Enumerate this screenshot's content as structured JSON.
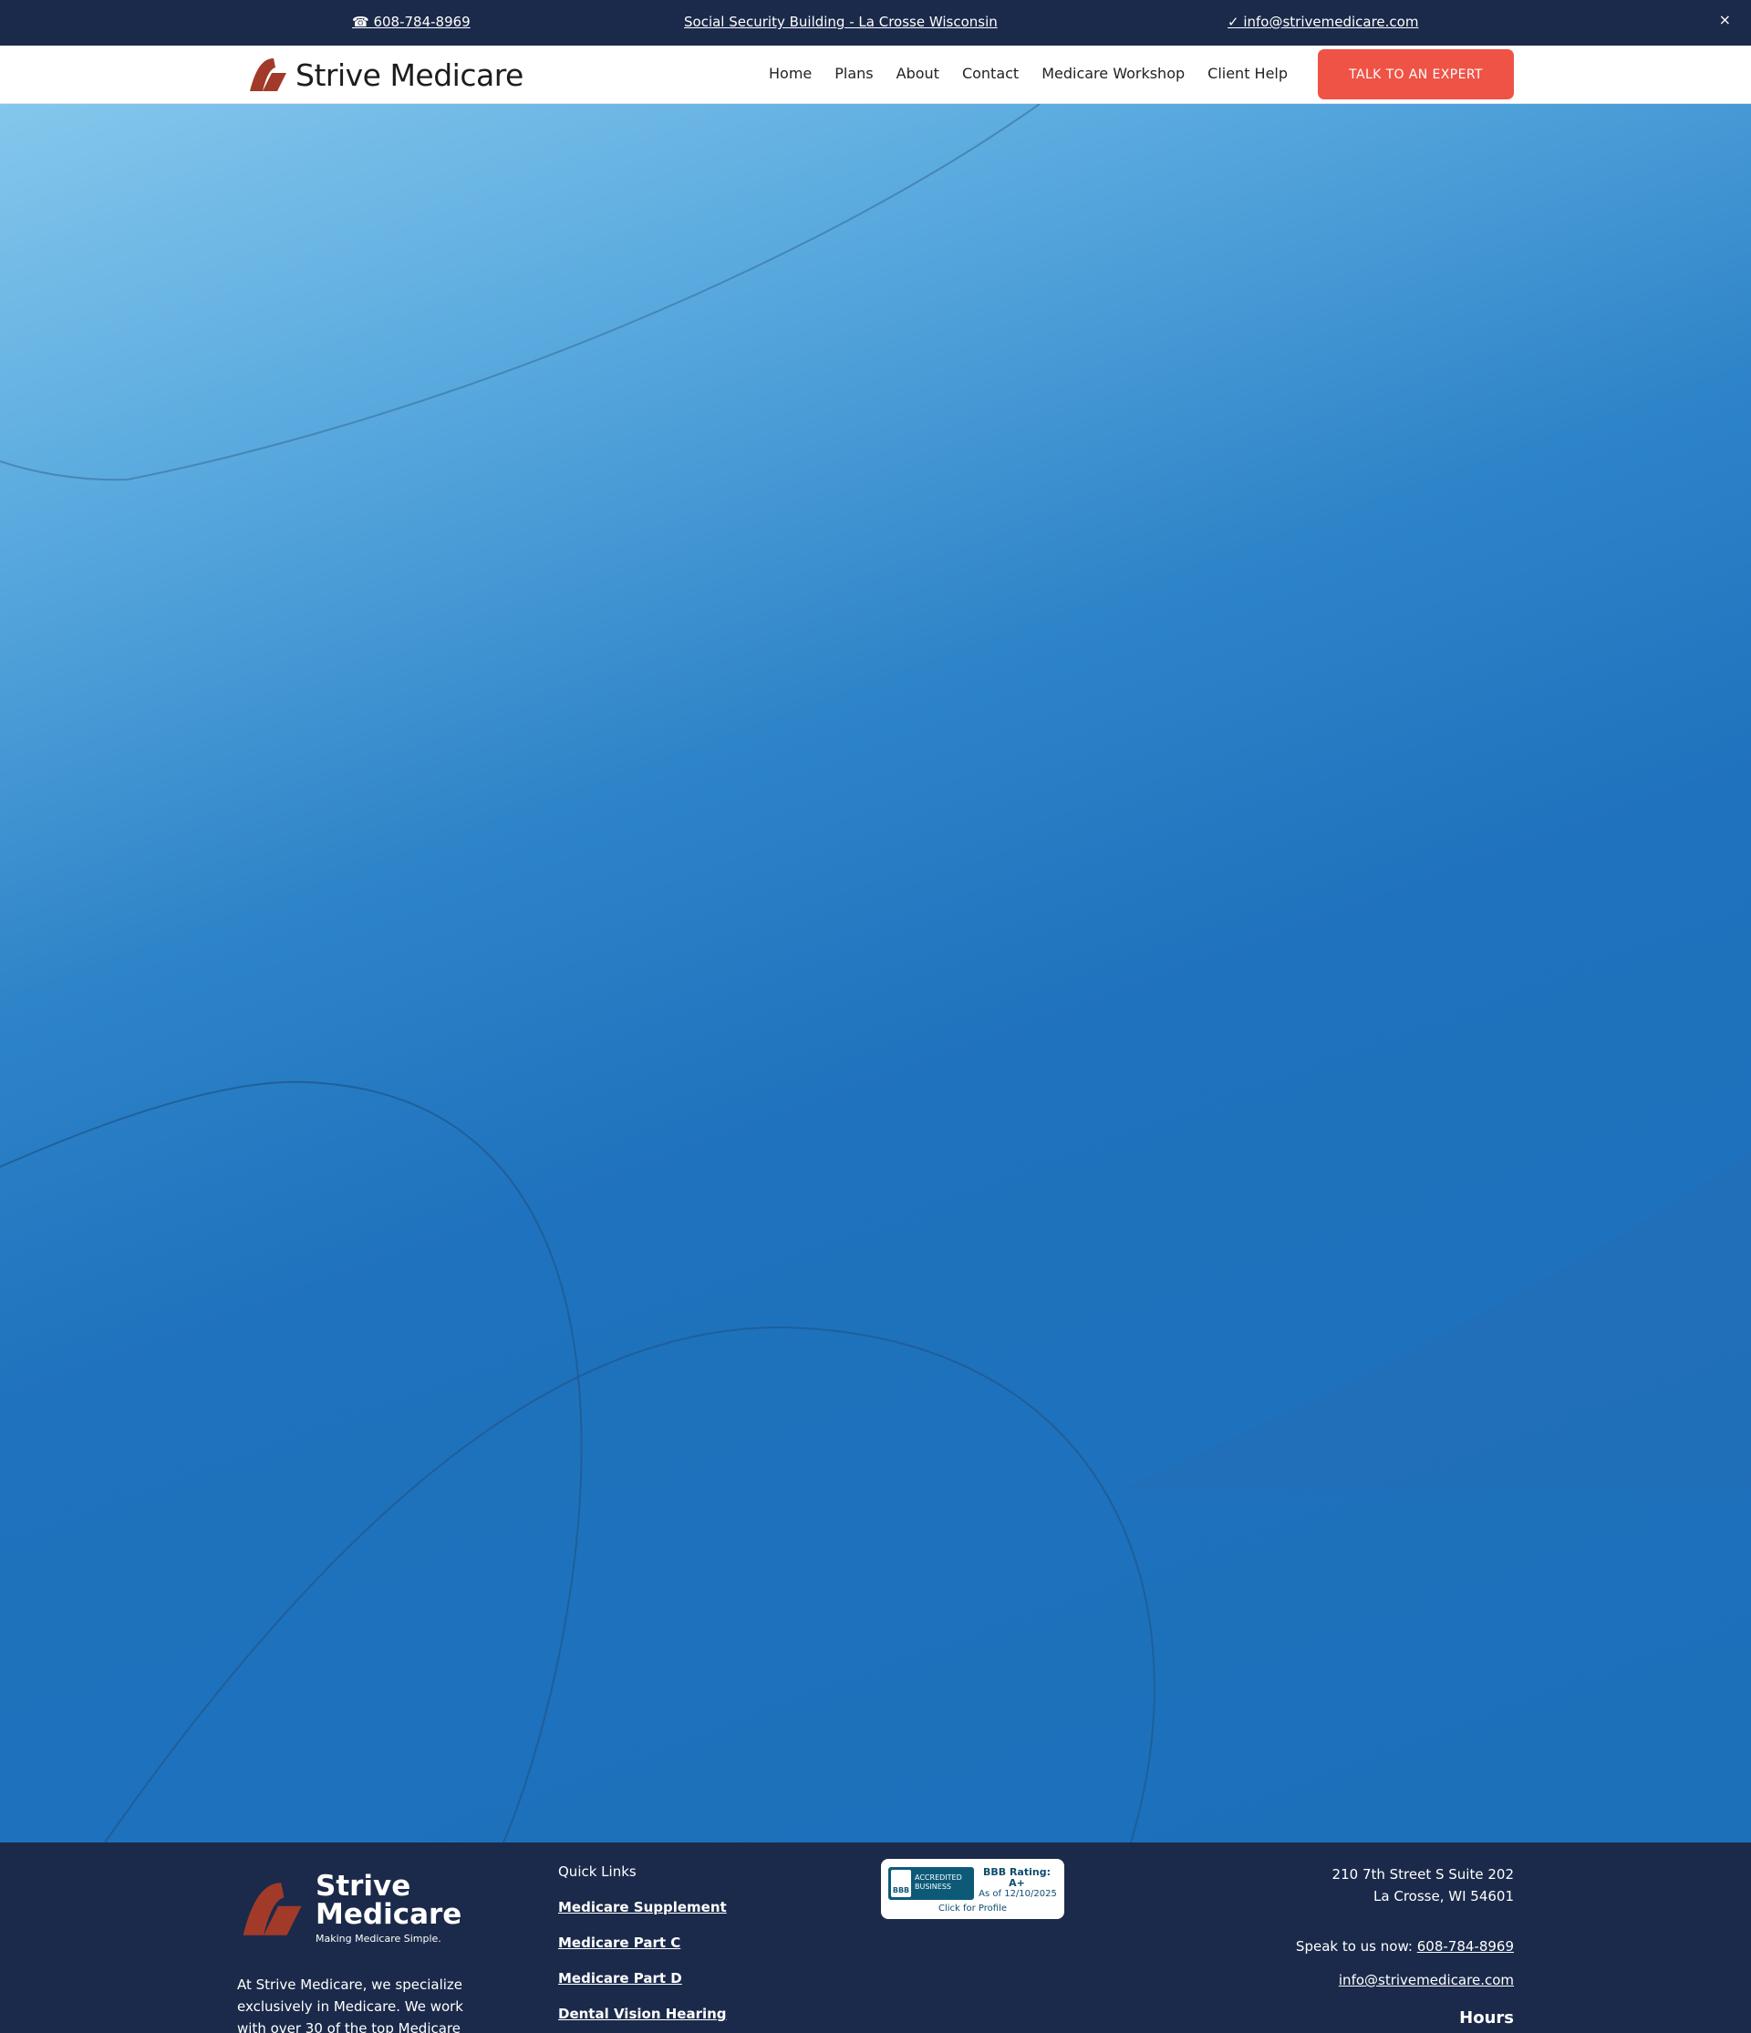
{
  "topbar": {
    "phone": "☎ 608-784-8969",
    "address": "  Social Security Building - La Crosse Wisconsin",
    "email": "✓ info@strivemedicare.com",
    "close": "×"
  },
  "header": {
    "brand": "Strive Medicare",
    "nav": [
      "Home",
      "Plans",
      "About",
      "Contact",
      "Medicare Workshop",
      "Client Help"
    ],
    "cta": "TALK TO AN EXPERT"
  },
  "colors": {
    "navy": "#1b2a4a",
    "accent": "#ef5346",
    "logo": "#a23a2a",
    "hero_blue": "#1c70ba"
  },
  "footer": {
    "brand_name": "Strive\nMedicare",
    "tagline": "Making Medicare Simple.",
    "about": "At Strive Medicare, we specialize exclusively in Medicare. We work with over 30 of the top Medicare",
    "quick_links_title": "Quick Links",
    "quick_links": [
      "Medicare Supplement",
      "Medicare Part C",
      "Medicare Part D",
      "Dental Vision Hearing"
    ],
    "bbb": {
      "mark": "BBB",
      "seal_text": "ACCREDITED\nBUSINESS",
      "rating": "BBB Rating: A+",
      "as_of": "As of 12/10/2025",
      "click": "Click for Profile"
    },
    "address_line1": "210 7th Street S Suite 202",
    "address_line2": "La Crosse, WI 54601",
    "speak_label": "Speak to us now:",
    "speak_phone": "608-784-8969",
    "email": "info@strivemedicare.com",
    "hours_title": "Hours"
  }
}
